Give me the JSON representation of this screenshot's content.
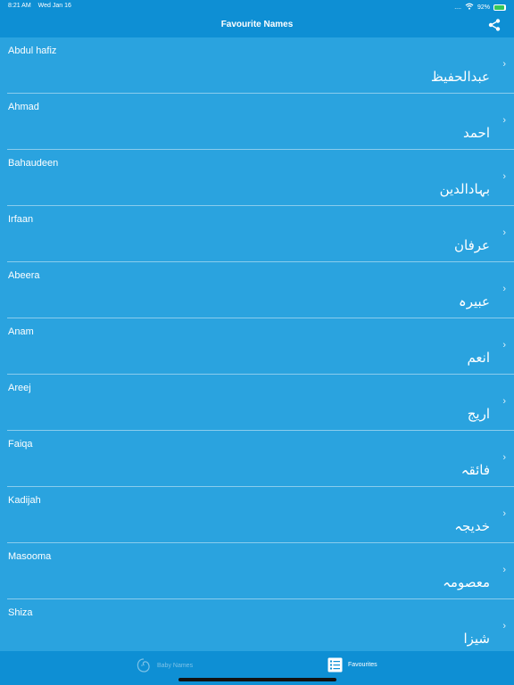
{
  "status": {
    "time": "8:21 AM",
    "date": "Wed Jan 16",
    "signal": "....",
    "battery": "92%",
    "battery_level": 0.92
  },
  "nav": {
    "title": "Favourite Names",
    "share_icon": "share-icon"
  },
  "names": [
    {
      "en": "Abdul hafiz",
      "ur": "عبدالحفیظ"
    },
    {
      "en": "Ahmad",
      "ur": "احمد"
    },
    {
      "en": "Bahaudeen",
      "ur": "بہادالدین"
    },
    {
      "en": "Irfaan",
      "ur": "عرفان"
    },
    {
      "en": "Abeera",
      "ur": "عبیرہ"
    },
    {
      "en": "Anam",
      "ur": "انعم"
    },
    {
      "en": "Areej",
      "ur": "اریج"
    },
    {
      "en": "Faiqa",
      "ur": "فائقہ"
    },
    {
      "en": "Kadijah",
      "ur": "خدیجہ"
    },
    {
      "en": "Masooma",
      "ur": "معصومہ"
    },
    {
      "en": "Shiza",
      "ur": "شیزا"
    }
  ],
  "tabs": [
    {
      "label": "Baby Names",
      "icon": "baby-icon",
      "active": false
    },
    {
      "label": "Favourites",
      "icon": "list-icon",
      "active": true
    }
  ],
  "colors": {
    "background": "#2aa3df",
    "bar": "#0e8fd4",
    "text": "#ffffff"
  }
}
